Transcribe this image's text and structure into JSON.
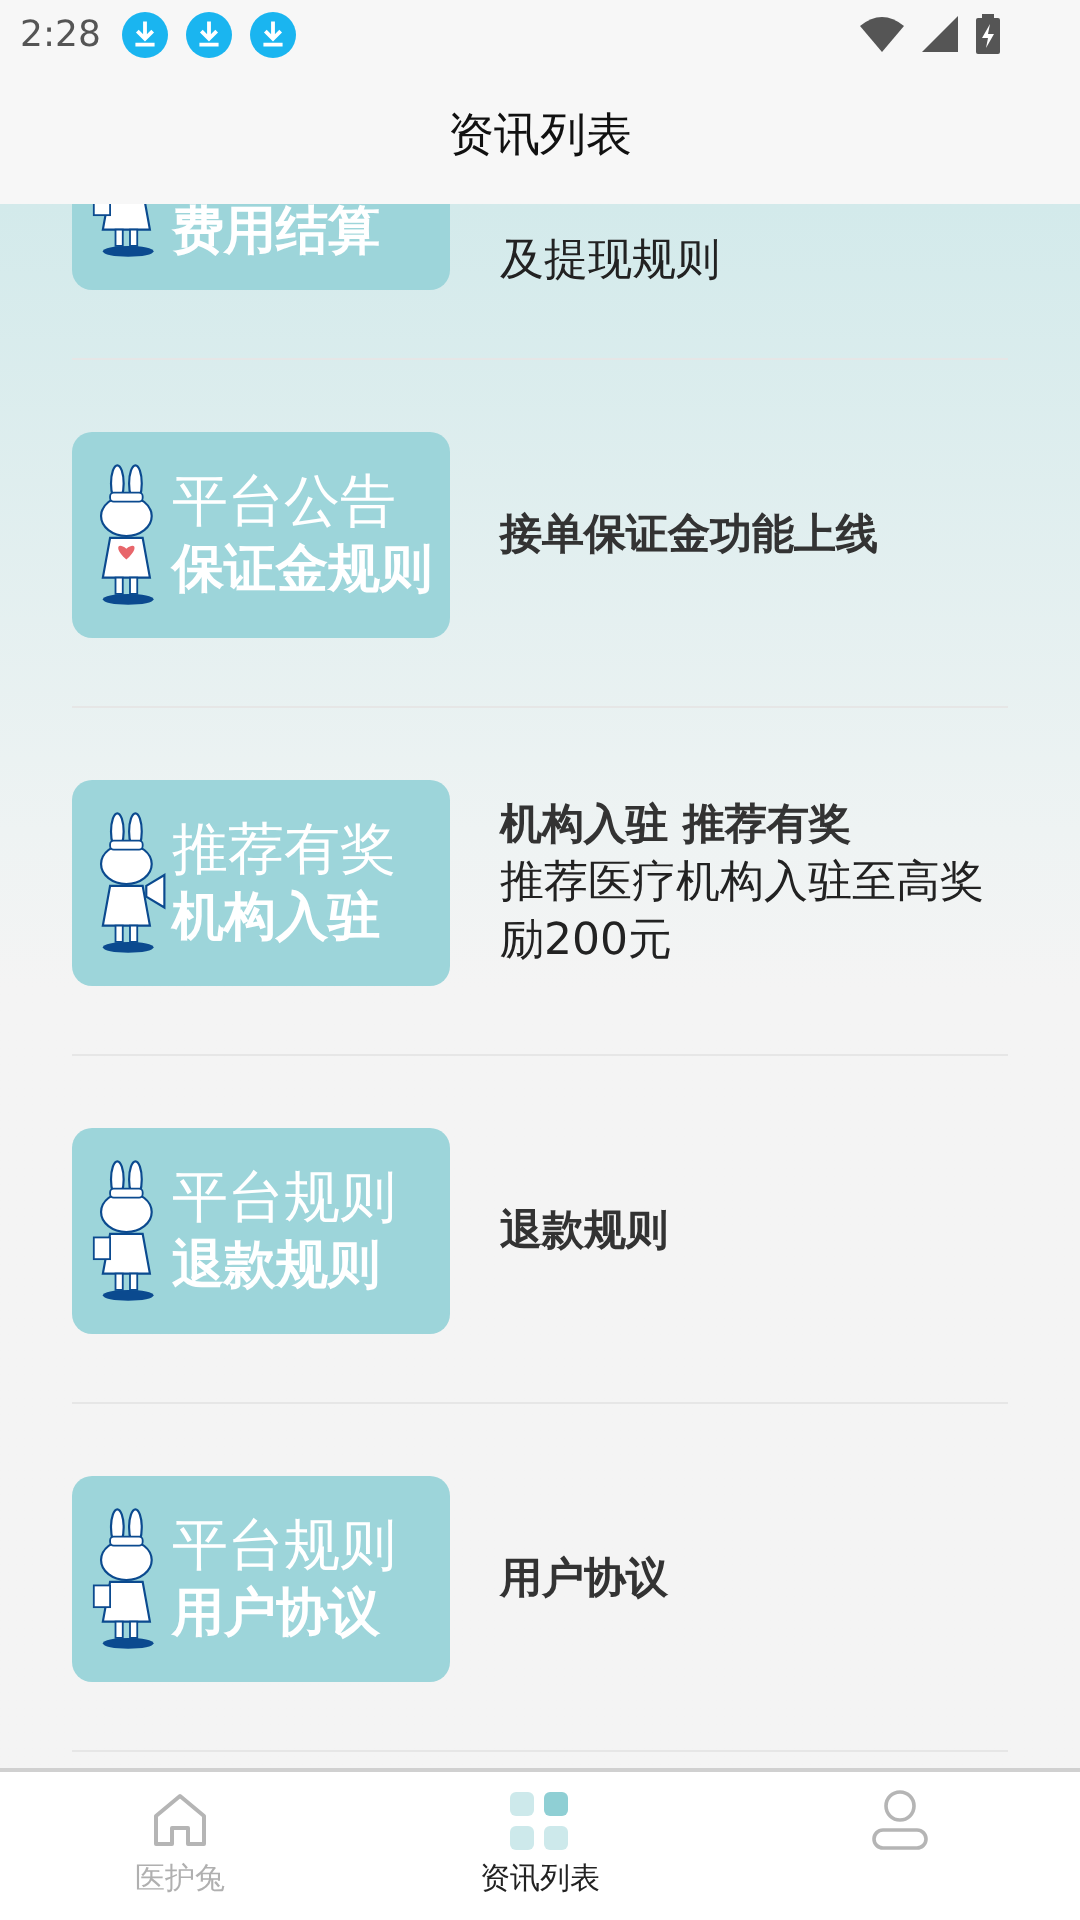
{
  "status_bar": {
    "time": "2:28"
  },
  "header": {
    "title": "资讯列表"
  },
  "articles": [
    {
      "banner": {
        "subtitle": "费用结算"
      },
      "body": "及提现规则"
    },
    {
      "banner": {
        "title": "平台公告",
        "subtitle": "保证金规则"
      },
      "title": "接单保证金功能上线"
    },
    {
      "banner": {
        "title": "推荐有奖",
        "subtitle": "机构入驻"
      },
      "title": "机构入驻 推荐有奖",
      "body": "推荐医疗机构入驻至高奖励200元"
    },
    {
      "banner": {
        "title": "平台规则",
        "subtitle": "退款规则"
      },
      "title": "退款规则"
    },
    {
      "banner": {
        "title": "平台规则",
        "subtitle": "用户协议"
      },
      "title": "用户协议"
    }
  ],
  "bottom_nav": [
    {
      "label": "医护兔",
      "selected": false
    },
    {
      "label": "资讯列表",
      "selected": true
    },
    {
      "selected": false
    }
  ]
}
